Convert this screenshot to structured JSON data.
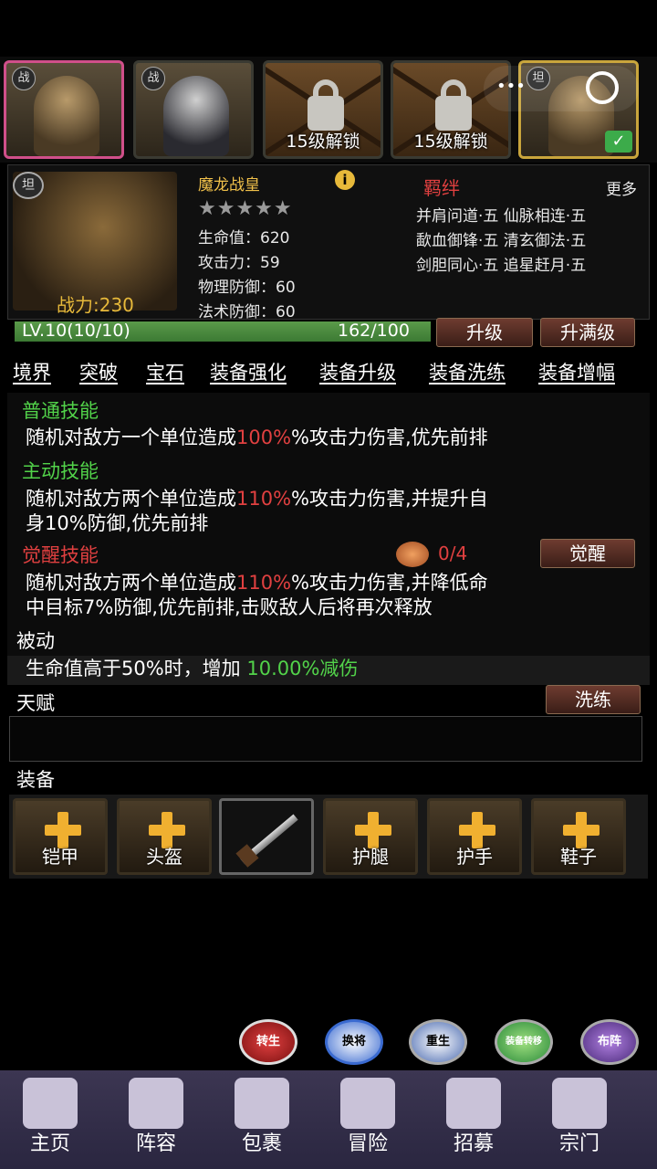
{
  "heroes": [
    {
      "tag": "战",
      "name": "hero-slot-1"
    },
    {
      "tag": "战",
      "name": "hero-slot-2"
    },
    {
      "lock_text": "15级解锁"
    },
    {
      "lock_text": "15级解锁"
    },
    {
      "tag": "坦",
      "selected": true
    }
  ],
  "hero": {
    "class_badge": "坦",
    "power": "战力:230",
    "name": "魔龙战皇",
    "info": "i",
    "stars": "★★★★★",
    "stats": [
      "生命值：620",
      "攻击力：59",
      "物理防御：60",
      "法术防御：60"
    ]
  },
  "bonds": {
    "title": "羁绊",
    "more": "更多",
    "lines": [
      "并肩问道·五 仙脉相连·五",
      "歃血御锋·五 清玄御法·五",
      "剑胆同心·五 追星赶月·五"
    ]
  },
  "level": {
    "label": "LV.10(10/10)",
    "exp": "162/100",
    "progress": 1.0,
    "upgrade_label": "升级",
    "max_upgrade_label": "升满级"
  },
  "tabs": [
    "境界",
    "突破",
    "宝石",
    "装备强化",
    "装备升级",
    "装备洗练",
    "装备增幅"
  ],
  "skills": {
    "normal": {
      "title": "普通技能",
      "pre": "随机对敌方一个单位造成",
      "value": "100%",
      "post": "%攻击力伤害,优先前排"
    },
    "active": {
      "title": "主动技能",
      "pre": "随机对敌方两个单位造成",
      "value": "110%",
      "post": "%攻击力伤害,并提升自",
      "line2": "身10%防御,优先前排"
    },
    "awaken": {
      "title": "觉醒技能",
      "count": "0/4",
      "button": "觉醒",
      "pre": "随机对敌方两个单位造成",
      "value": "110%",
      "post": "%攻击力伤害,并降低命",
      "line2": "中目标7%防御,优先前排,击败敌人后将再次释放"
    }
  },
  "passive": {
    "title": "被动",
    "pre": "生命值高于50%时，增加 ",
    "value": "10.00%减伤"
  },
  "talent": {
    "title": "天赋",
    "button": "洗练"
  },
  "equipment": {
    "title": "装备",
    "slots": [
      "铠甲",
      "头盔",
      "",
      "护腿",
      "护手",
      "鞋子"
    ]
  },
  "quick_actions": [
    "转生",
    "换将",
    "重生",
    "装备转移",
    "布阵"
  ],
  "nav": [
    "主页",
    "阵容",
    "包裹",
    "冒险",
    "招募",
    "宗门"
  ],
  "colors": {
    "accent_red": "#e04040",
    "accent_green": "#52d34a",
    "gold": "#f0c04a",
    "nav_bg": "#3c3652"
  }
}
